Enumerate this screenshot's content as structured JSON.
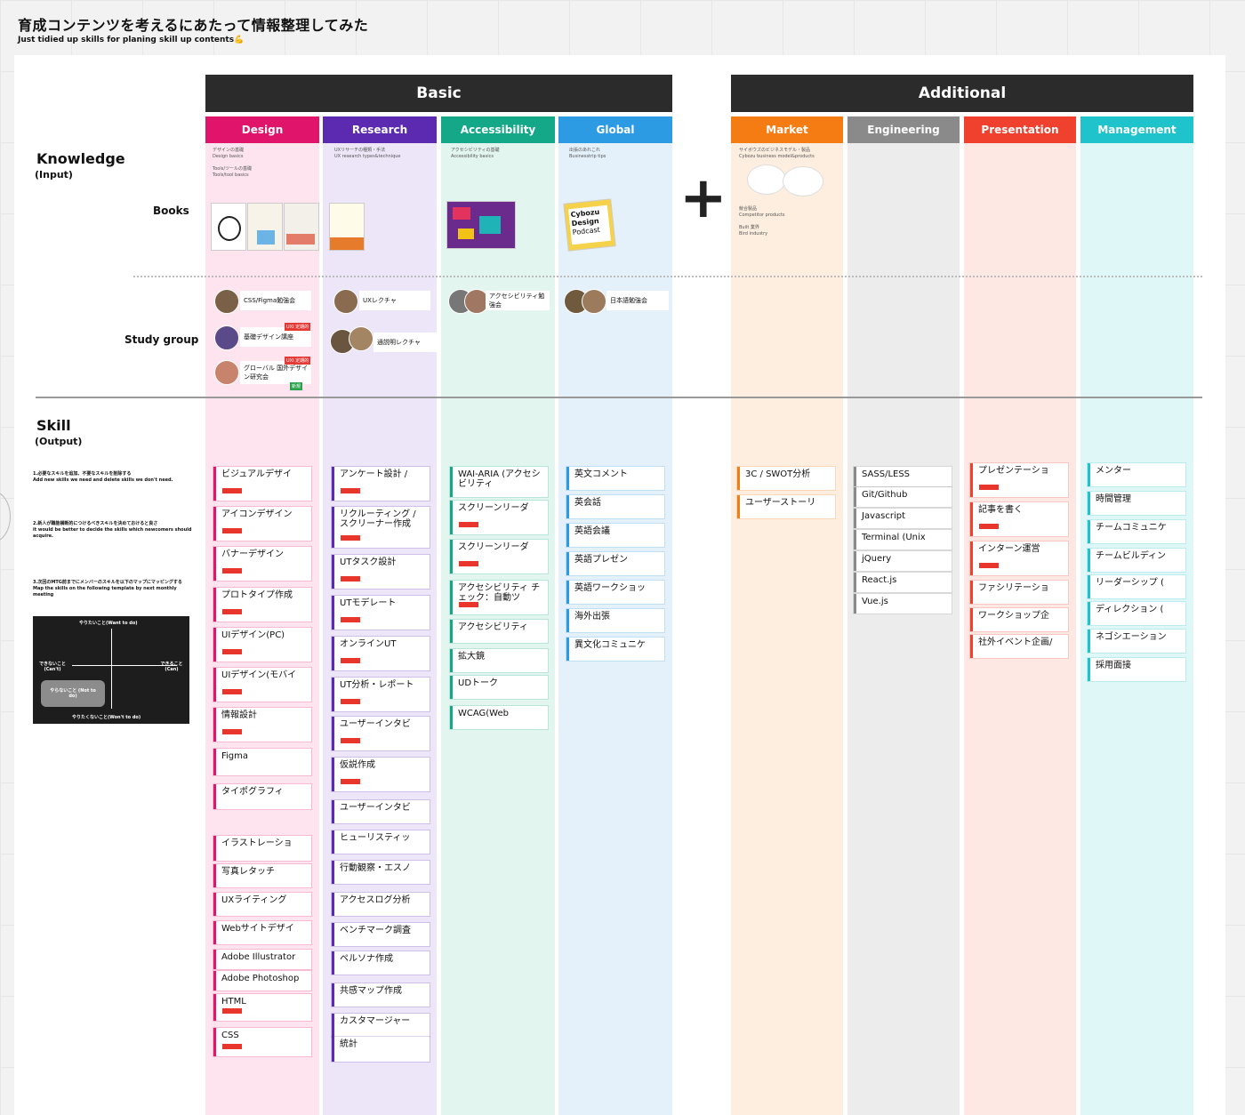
{
  "header": {
    "title": "育成コンテンツを考えるにあたって情報整理してみた",
    "subtitle": "Just tidied up skills for planing skill up contents💪"
  },
  "groups": {
    "basic": "Basic",
    "additional": "Additional"
  },
  "columns": [
    {
      "label": "Design",
      "head_color": "#e0146b",
      "bg_color": "#fde4ee"
    },
    {
      "label": "Research",
      "head_color": "#5b2ab0",
      "bg_color": "#ede6f8"
    },
    {
      "label": "Accessibility",
      "head_color": "#14a889",
      "bg_color": "#e2f5ef"
    },
    {
      "label": "Global",
      "head_color": "#2d9ae4",
      "bg_color": "#e4f1fb"
    },
    {
      "label": "Market",
      "head_color": "#f57c12",
      "bg_color": "#fdeee0"
    },
    {
      "label": "Engineering",
      "head_color": "#8a8a8a",
      "bg_color": "#ececec"
    },
    {
      "label": "Presentation",
      "head_color": "#f0412f",
      "bg_color": "#fde8e4"
    },
    {
      "label": "Management",
      "head_color": "#1ec3cc",
      "bg_color": "#e0f7f8"
    }
  ],
  "knowledge": {
    "title": "Knowledge",
    "sub": "(Input)",
    "books_label": "Books",
    "study_label": "Study group",
    "notes": {
      "design": [
        "デザインの基礎",
        "Design basics",
        "",
        "Tools/ツールの基礎",
        "Tools/tool basics"
      ],
      "research": [
        "UXリサーチの種類・手法",
        "UX research types&technique"
      ],
      "accessibility": [
        "アクセシビリティの基礎",
        "Accessibility basics"
      ],
      "global": [
        "出張のあれこれ",
        "Businesstrip tips"
      ],
      "market": [
        "サイボウズのビジネスモデル・製品",
        "Cybozu business model&products",
        "",
        "",
        "",
        "競合製品",
        "Competitor products",
        "",
        "Built 業界",
        "Bird industry"
      ]
    },
    "study_groups": {
      "design": [
        "CSS/Figma勉強会",
        "基礎デザイン講座",
        "グローバル 国外デザイン研究会"
      ],
      "research": [
        "UXレクチャ",
        "通説明レクチャ"
      ],
      "accessibility": [
        "アクセシビリティ勉強会"
      ],
      "global": [
        "日本語勉強会"
      ]
    },
    "chips": [
      "UXI 定期的",
      "UXI 定期的"
    ],
    "badge": "新規",
    "book_cover": [
      "Cybozu",
      "Design",
      "Podcast"
    ]
  },
  "skill": {
    "title": "Skill",
    "sub": "(Output)",
    "notes": [
      {
        "jp": "1.必要なスキルを追加、不要なスキルを削除する",
        "en": "Add new skills we need and delete skills we don't need."
      },
      {
        "jp": "2.新人が職能横断的につけるべきスキルを決めておけると良さ",
        "en": "it would be better to decide the skills which newcomers should acquire."
      },
      {
        "jp": "3.次回のMTG前までにメンバーのスキルを以下のマップにマッピングする",
        "en": "Map the skills on the following template by next monthly meeting"
      }
    ],
    "matrix": {
      "top": "やりたいこと(Want to do)",
      "bottom": "やりたくないこと(Won't to do)",
      "left": "できないこと (Can't)",
      "right": "できること (Can)",
      "box": "やらないこと (Not to do)"
    },
    "cards": {
      "design": [
        "ビジュアルデザイ",
        "アイコンデザイン",
        "バナーデザイン",
        "プロトタイプ作成",
        "UIデザイン(PC)",
        "UIデザイン(モバイ",
        "情報設計",
        "Figma",
        "タイポグラフィ",
        "イラストレーショ",
        "写真レタッチ",
        "UXライティング",
        "Webサイトデザイ",
        "Adobe Illustrator",
        "Adobe Photoshop",
        "HTML",
        "CSS"
      ],
      "research": [
        "アンケート設計 /",
        "リクルーティング / スクリーナー作成",
        "UTタスク設計",
        "UTモデレート",
        "オンラインUT",
        "UT分析・レポート",
        "ユーザーインタビ",
        "仮説作成",
        "ユーザーインタビ",
        "ヒューリスティッ",
        "行動観察・エスノ",
        "アクセスログ分析",
        "ベンチマーク調査",
        "ペルソナ作成",
        "共感マップ作成",
        "カスタマージャー",
        "統計"
      ],
      "accessibility": [
        "WAI-ARIA (アクセシビリティ",
        "スクリーンリーダ",
        "スクリーンリーダ",
        "アクセシビリティ チェック：自動ツ",
        "アクセシビリティ",
        "拡大鏡",
        "UDトーク",
        "WCAG(Web"
      ],
      "global": [
        "英文コメント",
        "英会話",
        "英語会議",
        "英語プレゼン",
        "英語ワークショッ",
        "海外出張",
        "異文化コミュニケ"
      ],
      "market": [
        "3C / SWOT分析",
        "ユーザーストーリ"
      ],
      "engineering": [
        "SASS/LESS",
        "Git/Github",
        "Javascript",
        "Terminal (Unix",
        "jQuery",
        "React.js",
        "Vue.js"
      ],
      "presentation": [
        "プレゼンテーショ",
        "記事を書く",
        "インターン運営",
        "ファシリテーショ",
        "ワークショップ企",
        "社外イベント企画/"
      ],
      "management": [
        "メンター",
        "時間管理",
        "チームコミュニケ",
        "チームビルディン",
        "リーダーシップ (",
        "ディレクション (",
        "ネゴシエーション",
        "採用面接"
      ]
    }
  },
  "colors": {
    "bar_red": "#e8362d",
    "header_dark": "#2b2b2b"
  },
  "icons": {
    "plus": "+"
  }
}
